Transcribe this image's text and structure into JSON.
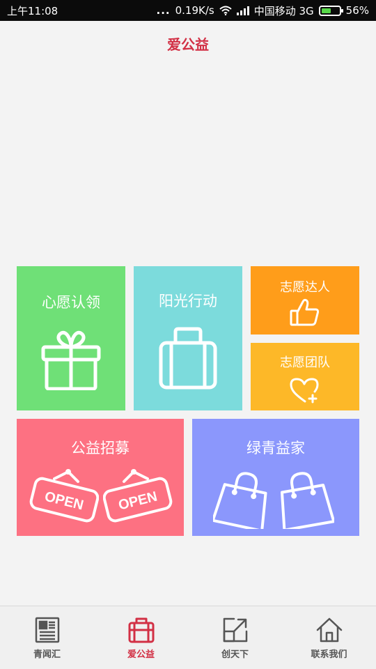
{
  "status_bar": {
    "time": "上午11:08",
    "dots": "...",
    "speed": "0.19K/s",
    "carrier": "中国移动 3G",
    "battery": "56%",
    "battery_level": 0.56
  },
  "header": {
    "title": "爱公益"
  },
  "tiles": {
    "xinyuan": {
      "label": "心愿认领",
      "icon": "gift-icon"
    },
    "yangguang": {
      "label": "阳光行动",
      "icon": "briefcase-icon"
    },
    "daren": {
      "label": "志愿达人",
      "icon": "thumbs-up-icon"
    },
    "tuandui": {
      "label": "志愿团队",
      "icon": "heart-plus-icon"
    },
    "zhaomu": {
      "label": "公益招募",
      "icon": "open-sign-icon",
      "sign_text": "OPEN"
    },
    "lvqing": {
      "label": "绿青益家",
      "icon": "shopping-bag-icon"
    }
  },
  "colors": {
    "accent": "#d23045",
    "xinyuan": "#6fe077",
    "yangguang": "#7cdbdc",
    "daren": "#ff9d1a",
    "tuandui": "#fdb828",
    "zhaomu": "#fd7182",
    "lvqing": "#8b97fc"
  },
  "bottom_nav": [
    {
      "label": "青闻汇",
      "icon": "newspaper-icon",
      "active": false
    },
    {
      "label": "爱公益",
      "icon": "briefcase-icon",
      "active": true
    },
    {
      "label": "创天下",
      "icon": "expand-icon",
      "active": false
    },
    {
      "label": "联系我们",
      "icon": "home-icon",
      "active": false
    }
  ]
}
